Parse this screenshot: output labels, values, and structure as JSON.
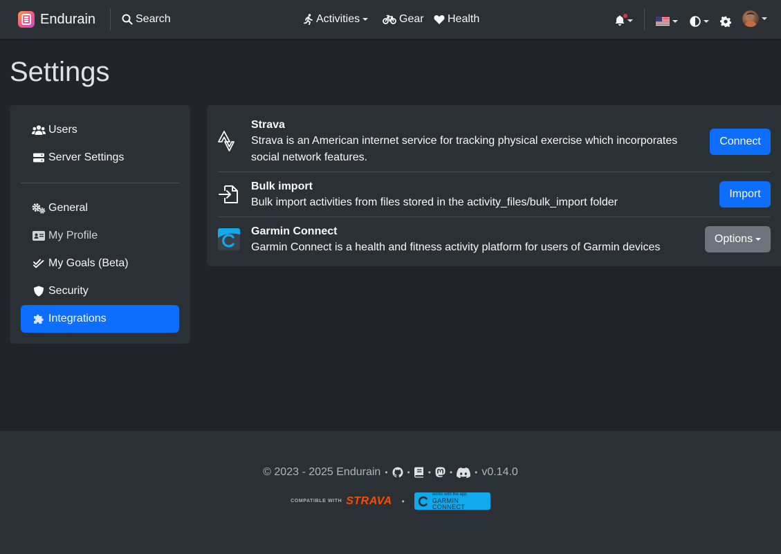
{
  "navbar": {
    "brand": "Endurain",
    "search_label": "Search",
    "activities_label": "Activities",
    "gear_label": "Gear",
    "health_label": "Health"
  },
  "page": {
    "title": "Settings"
  },
  "sidebar": {
    "items": [
      {
        "label": "Users",
        "icon": "users-icon"
      },
      {
        "label": "Server Settings",
        "icon": "server-icon"
      },
      {
        "label": "General",
        "icon": "gears-icon"
      },
      {
        "label": "My Profile",
        "icon": "id-card-icon"
      },
      {
        "label": "My Goals (Beta)",
        "icon": "check-double-icon"
      },
      {
        "label": "Security",
        "icon": "shield-icon"
      },
      {
        "label": "Integrations",
        "icon": "puzzle-icon",
        "active": true
      }
    ]
  },
  "integrations": [
    {
      "title": "Strava",
      "description": "Strava is an American internet service for tracking physical exercise which incorporates social network features.",
      "button": "Connect",
      "icon": "strava-icon"
    },
    {
      "title": "Bulk import",
      "description": "Bulk import activities from files stored in the activity_files/bulk_import folder",
      "button": "Import",
      "icon": "file-import-icon"
    },
    {
      "title": "Garmin Connect",
      "description": "Garmin Connect is a health and fitness activity platform for users of Garmin devices",
      "button": "Options",
      "icon": "garmin-connect-icon"
    }
  ],
  "footer": {
    "copyright": "© 2023 - 2025 Endurain",
    "version": "v0.14.0",
    "strava_badge_small": "COMPATIBLE WITH",
    "strava_badge_word": "STRAVA",
    "garmin_badge_small": "works with the app",
    "garmin_badge_big": "GARMIN CONNECT"
  },
  "colors": {
    "primary": "#0d6efd",
    "secondary": "#6c757d",
    "background": "#212529",
    "surface": "#2b3035",
    "strava": "#fc4c02",
    "garmin": "#11a9ed"
  }
}
